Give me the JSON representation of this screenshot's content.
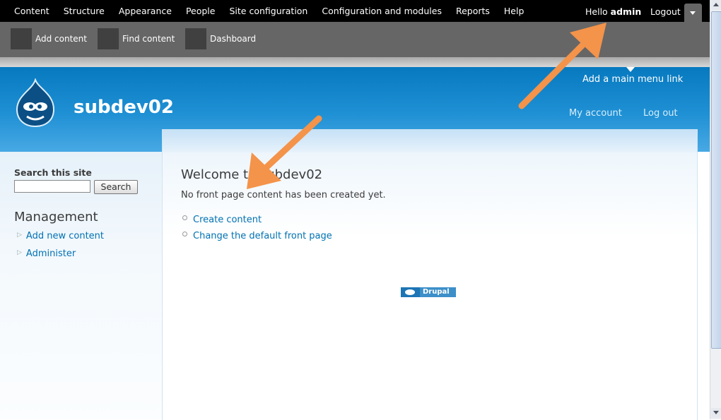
{
  "admin_toolbar": {
    "menu": [
      "Content",
      "Structure",
      "Appearance",
      "People",
      "Site configuration",
      "Configuration and modules",
      "Reports",
      "Help"
    ],
    "hello_prefix": "Hello ",
    "username": "admin",
    "logout": "Logout"
  },
  "shortcuts": [
    "Add content",
    "Find content",
    "Dashboard"
  ],
  "header": {
    "site_name": "subdev02",
    "main_menu_link": "Add a main menu link",
    "my_account": "My account",
    "log_out": "Log out"
  },
  "sidebar": {
    "search_title": "Search this site",
    "search_value": "",
    "search_button": "Search",
    "management_title": "Management",
    "links": [
      "Add new content",
      "Administer"
    ]
  },
  "content": {
    "title": "Welcome to subdev02",
    "message": "No front page content has been created yet.",
    "links": [
      "Create content",
      "Change the default front page"
    ],
    "badge": "Drupal"
  },
  "colors": {
    "accent_link": "#0071b3",
    "header_blue": "#0779bf",
    "annotation_arrow": "#f4934a"
  },
  "icons": {
    "logo": "drupal-drop-logo",
    "toolbar_toggle": "chevron-down-icon"
  }
}
